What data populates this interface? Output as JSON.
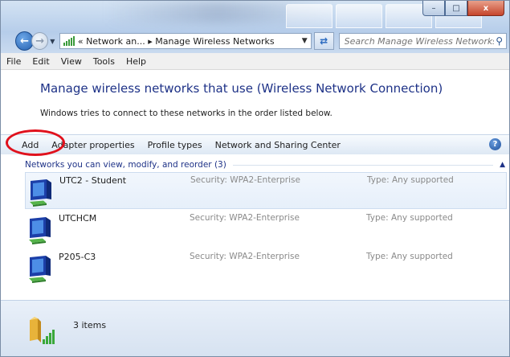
{
  "window": {
    "caption": {
      "minimize": "–",
      "maximize": "□",
      "close": "x"
    }
  },
  "nav": {
    "address_segments": [
      "«",
      "Network an...",
      "▸",
      "Manage Wireless Networks"
    ],
    "search_placeholder": "Search Manage Wireless Networks"
  },
  "menu": [
    "File",
    "Edit",
    "View",
    "Tools",
    "Help"
  ],
  "header": {
    "title": "Manage wireless networks that use (Wireless Network Connection)",
    "description": "Windows tries to connect to these networks in the order listed below."
  },
  "toolbar": {
    "add": "Add",
    "adapter": "Adapter properties",
    "profile": "Profile types",
    "sharing": "Network and Sharing Center",
    "help": "?"
  },
  "group": {
    "title": "Networks you can view, modify, and reorder (3)"
  },
  "networks": [
    {
      "name": "UTC2 - Student",
      "security": "Security: WPA2-Enterprise",
      "type": "Type: Any supported"
    },
    {
      "name": "UTCHCM",
      "security": "Security: WPA2-Enterprise",
      "type": "Type: Any supported"
    },
    {
      "name": "P205-C3",
      "security": "Security: WPA2-Enterprise",
      "type": "Type: Any supported"
    }
  ],
  "status": {
    "count": "3 items"
  },
  "colors": {
    "title_blue": "#1e3287",
    "highlight_red": "#e0111c",
    "muted_text": "#8a8a8a"
  },
  "icons": {
    "back": "back-arrow-icon",
    "forward": "forward-arrow-icon",
    "network": "wireless-network-icon",
    "folder": "wireless-folder-icon",
    "search": "search-icon",
    "help": "help-icon"
  }
}
